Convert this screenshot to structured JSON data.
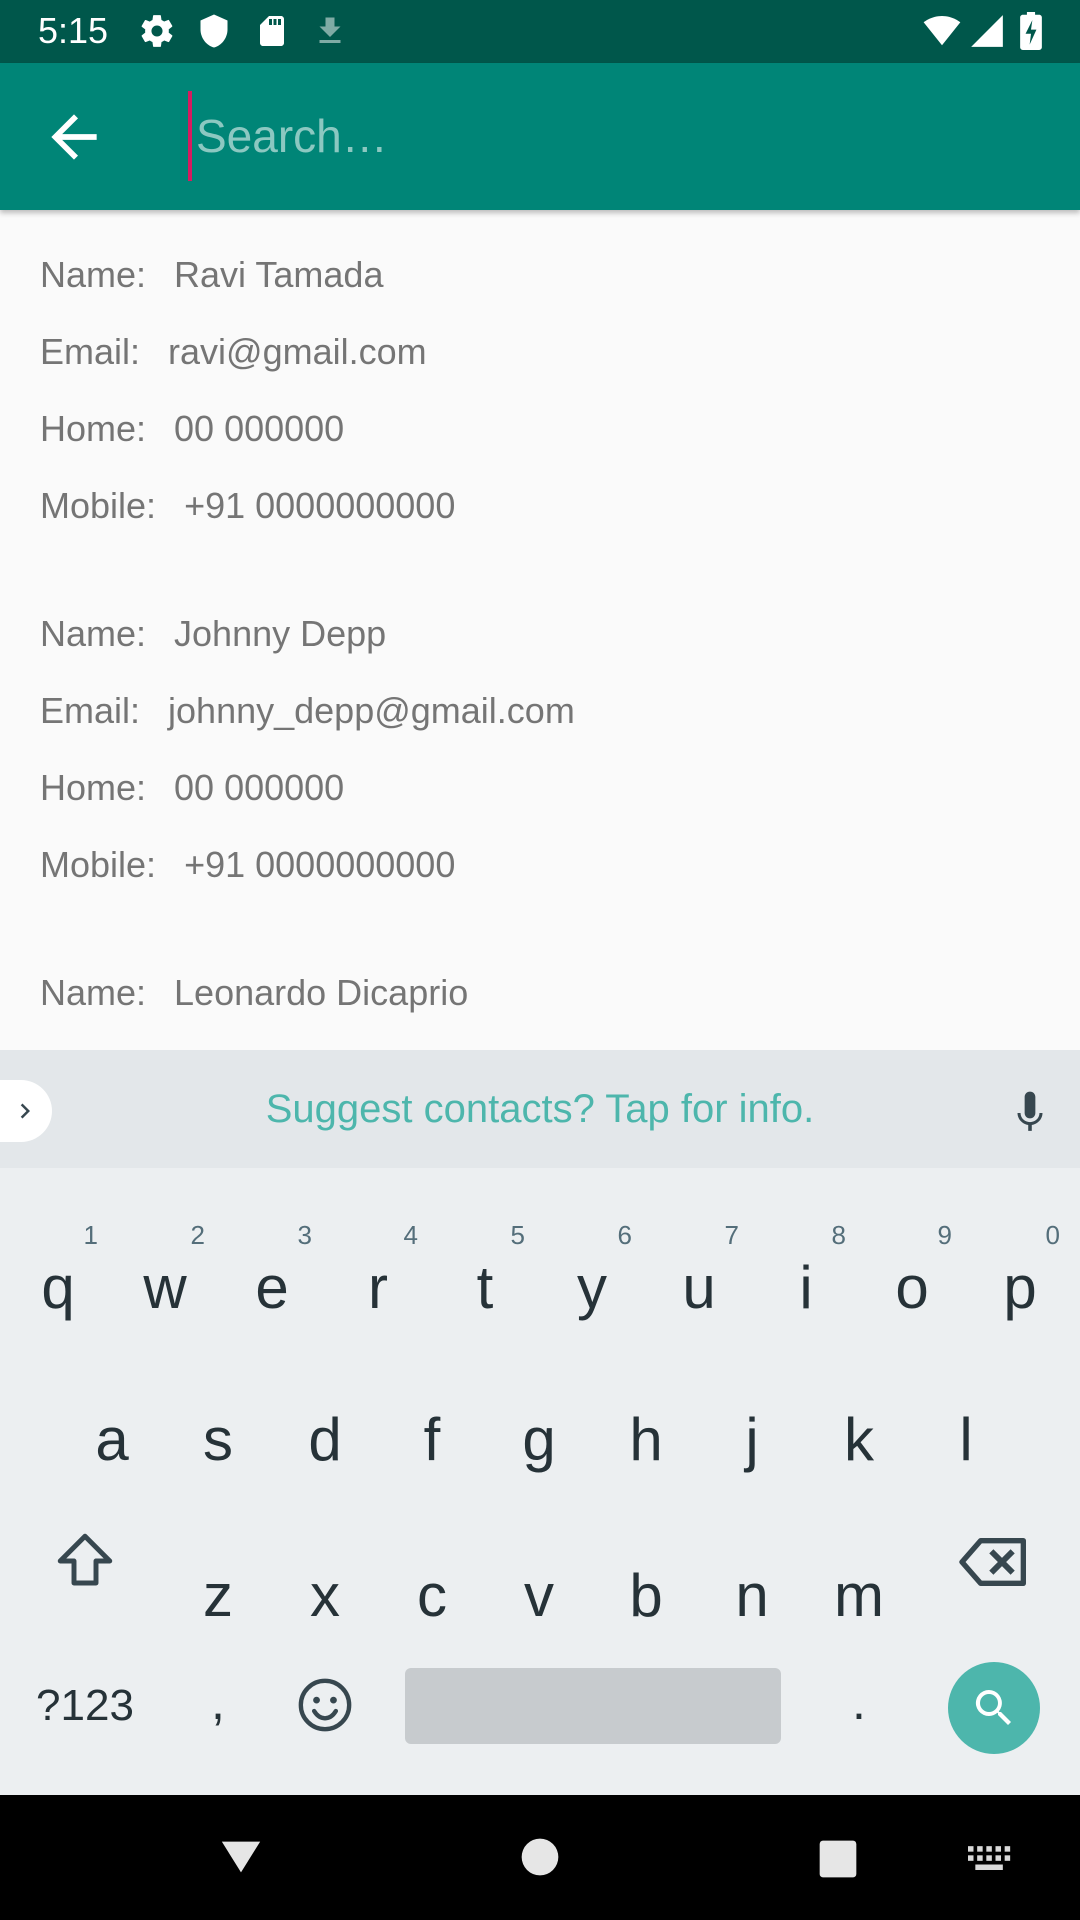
{
  "status_bar": {
    "time": "5:15",
    "icons": [
      "gear-icon",
      "shield-icon",
      "sd-card-icon",
      "download-icon",
      "wifi-icon",
      "signal-icon",
      "battery-charging-icon"
    ]
  },
  "app_bar": {
    "search_placeholder": "Search…",
    "search_value": "",
    "colors": {
      "primary": "#008577",
      "primary_dark": "#00574b",
      "accent": "#d81b60"
    }
  },
  "contacts": [
    {
      "name_label": "Name:",
      "name": "Ravi Tamada",
      "email_label": "Email:",
      "email": "ravi@gmail.com",
      "home_label": "Home:",
      "home": "00 000000",
      "mobile_label": "Mobile:",
      "mobile": "+91 0000000000"
    },
    {
      "name_label": "Name:",
      "name": "Johnny Depp",
      "email_label": "Email:",
      "email": "johnny_depp@gmail.com",
      "home_label": "Home:",
      "home": "00 000000",
      "mobile_label": "Mobile:",
      "mobile": "+91 0000000000"
    },
    {
      "name_label": "Name:",
      "name": "Leonardo Dicaprio"
    }
  ],
  "keyboard": {
    "suggestion": "Suggest contacts? Tap for info.",
    "row1": [
      {
        "key": "q",
        "hint": "1"
      },
      {
        "key": "w",
        "hint": "2"
      },
      {
        "key": "e",
        "hint": "3"
      },
      {
        "key": "r",
        "hint": "4"
      },
      {
        "key": "t",
        "hint": "5"
      },
      {
        "key": "y",
        "hint": "6"
      },
      {
        "key": "u",
        "hint": "7"
      },
      {
        "key": "i",
        "hint": "8"
      },
      {
        "key": "o",
        "hint": "9"
      },
      {
        "key": "p",
        "hint": "0"
      }
    ],
    "row2": [
      "a",
      "s",
      "d",
      "f",
      "g",
      "h",
      "j",
      "k",
      "l"
    ],
    "row3": [
      "z",
      "x",
      "c",
      "v",
      "b",
      "n",
      "m"
    ],
    "symbols_key": "?123",
    "comma_key": ",",
    "period_key": ".",
    "accent_color": "#4db6ac"
  },
  "nav_bar": {
    "icons": [
      "back-triangle-icon",
      "home-circle-icon",
      "recents-square-icon",
      "keyboard-switch-icon"
    ]
  }
}
